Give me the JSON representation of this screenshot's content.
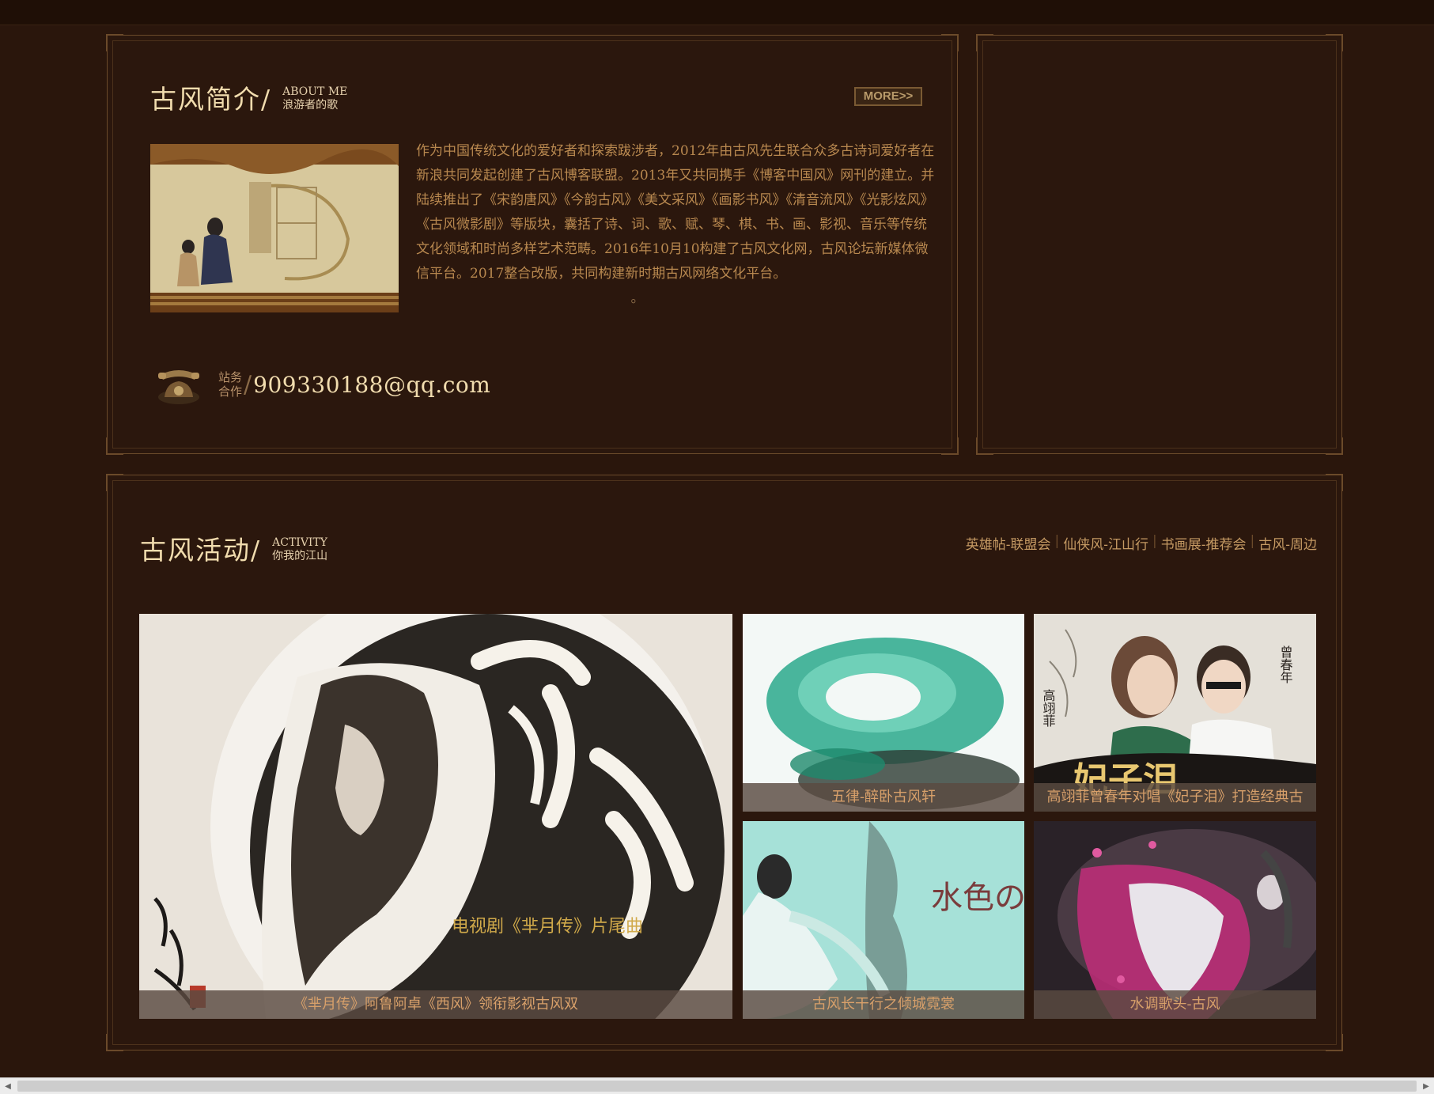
{
  "about": {
    "title": "古风简介/",
    "sub_en": "ABOUT ME",
    "sub_cn": "浪游者的歌",
    "more_label": "MORE>>",
    "paragraph": "作为中国传统文化的爱好者和探索跋涉者，2012年由古风先生联合众多古诗词爱好者在新浪共同发起创建了古风博客联盟。2013年又共同携手《博客中国风》网刊的建立。并陆续推出了《宋韵唐风》《今韵古风》《美文采风》《画影书风》《清音流风》《光影炫风》《古风微影剧》等版块，囊括了诗、词、歌、赋、琴、棋、书、画、影视、音乐等传统文化领域和时尚多样艺术范畴。2016年10月10构建了古风文化网，古风论坛新媒体微信平台。2017整合改版，共同构建新时期古风网络文化平台。",
    "dot": "。",
    "contact_label_1": "站务",
    "contact_label_2": "合作",
    "contact_slash": "/",
    "email": "909330188@qq.com"
  },
  "activity": {
    "title": "古风活动/",
    "sub_en": "ACTIVITY",
    "sub_cn": "你我的江山",
    "links": [
      "英雄帖-联盟会",
      "仙侠风-江山行",
      "书画展-推荐会",
      "古风-周边"
    ],
    "link_separator": "|",
    "tiles": [
      {
        "caption": "《芈月传》阿鲁阿卓《西风》领衔影视古风双",
        "poster_text": "电视剧《芈月传》片尾曲"
      },
      {
        "caption": "五律-醉卧古风轩"
      },
      {
        "caption": "高翊菲曾春年对唱《妃子泪》打造经典古",
        "poster_title": "妃子泪",
        "name_left": "高翊菲",
        "name_right": "曾春年"
      },
      {
        "caption": "古风长干行之倾城霓裳",
        "poster_text": "水色の诗"
      },
      {
        "caption": "水调歌头-古风"
      }
    ]
  },
  "icons": [
    "phone-icon",
    "scroll-left-icon",
    "scroll-right-icon"
  ],
  "colors": {
    "background": "#2a160c",
    "frame": "#6b4a2a",
    "title": "#f1dcae",
    "body_text": "#b8884f"
  }
}
